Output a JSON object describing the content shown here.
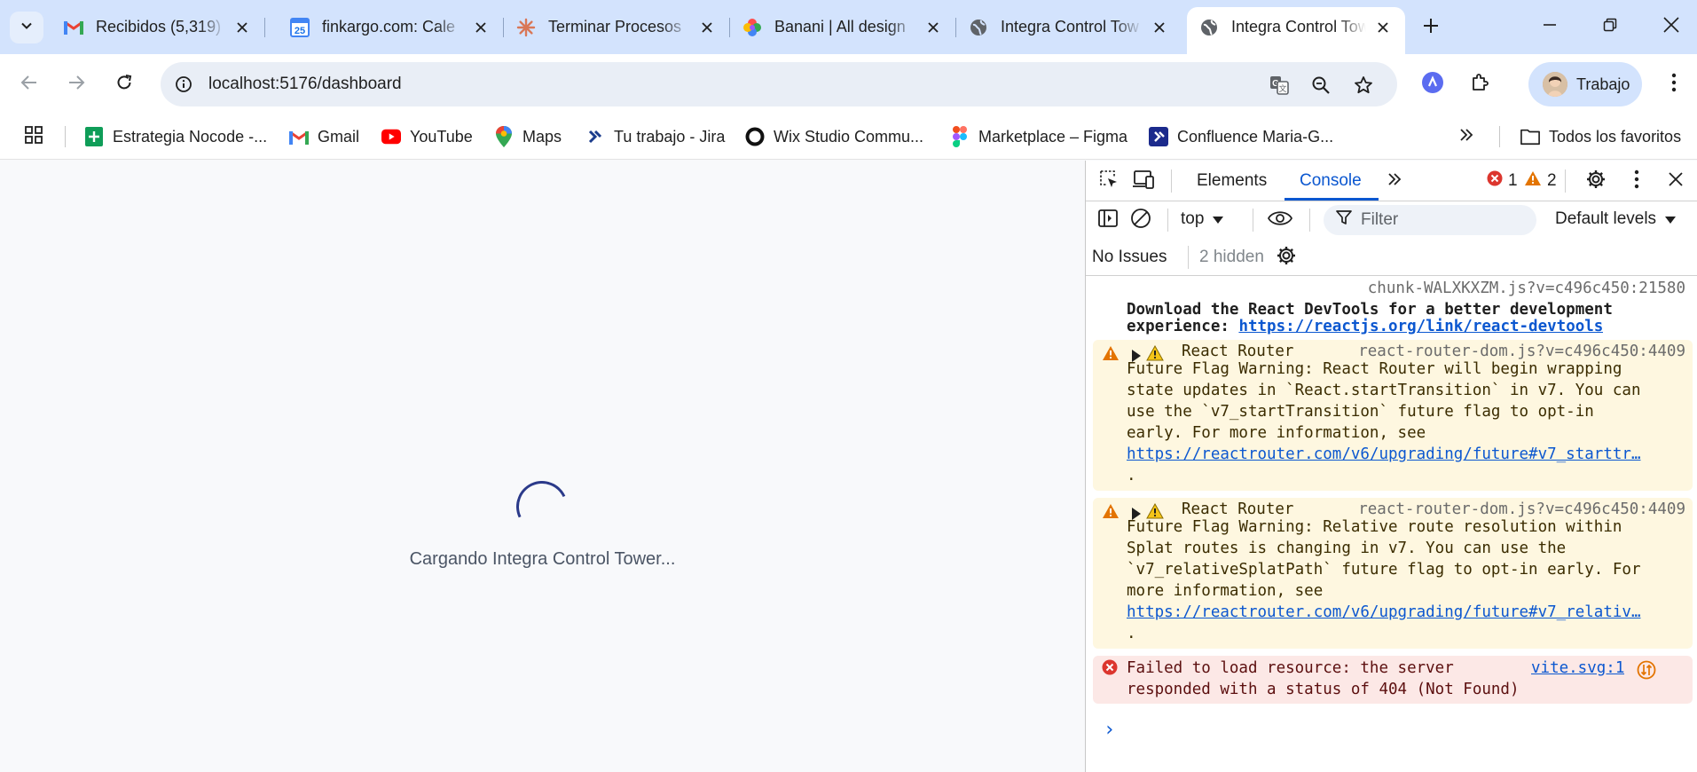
{
  "browser": {
    "tabs": [
      {
        "title": "Recibidos (5,319) -",
        "icon": "gmail-icon"
      },
      {
        "title": "finkargo.com: Cale",
        "icon": "calendar-icon"
      },
      {
        "title": "Terminar Procesos",
        "icon": "claude-icon"
      },
      {
        "title": "Banani | All design",
        "icon": "banani-icon"
      },
      {
        "title": "Integra Control Tow",
        "icon": "globe-icon"
      },
      {
        "title": "Integra Control Tow",
        "icon": "globe-icon",
        "active": true
      }
    ],
    "calendar_day": "25",
    "url": "localhost:5176/dashboard",
    "profile_label": "Trabajo"
  },
  "bookmarks": {
    "items": [
      {
        "label": "Estrategia Nocode -..."
      },
      {
        "label": "Gmail"
      },
      {
        "label": "YouTube"
      },
      {
        "label": "Maps"
      },
      {
        "label": "Tu trabajo - Jira"
      },
      {
        "label": "Wix Studio Commu..."
      },
      {
        "label": "Marketplace – Figma"
      },
      {
        "label": "Confluence Maria-G..."
      }
    ],
    "more_label": "Todos los favoritos"
  },
  "page": {
    "loading_text": "Cargando Integra Control Tower..."
  },
  "devtools": {
    "tabs": {
      "elements": "Elements",
      "console": "Console"
    },
    "error_count": "1",
    "warning_count": "2",
    "context": "top",
    "filter_placeholder": "Filter",
    "levels": "Default levels",
    "issues": "No Issues",
    "hidden": "2 hidden",
    "messages": {
      "info": {
        "source": "chunk-WALXKXZM.js?v=c496c450:21580",
        "line1": "Download the React DevTools for a better development",
        "line2_prefix": "experience: ",
        "link": "https://reactjs.org/link/react-devtools"
      },
      "warn1": {
        "head": "React Router",
        "source": "react-router-dom.js?v=c496c450:4409",
        "lines": [
          "Future Flag Warning: React Router will begin wrapping",
          "state updates in `React.startTransition` in v7. You can",
          "use the `v7_startTransition` future flag to opt-in",
          "early. For more information, see"
        ],
        "link": "https://reactrouter.com/v6/upgrading/future#v7_starttr…",
        "tail": "."
      },
      "warn2": {
        "head": "React Router",
        "source": "react-router-dom.js?v=c496c450:4409",
        "lines": [
          "Future Flag Warning: Relative route resolution within",
          "Splat routes is changing in v7. You can use the",
          "`v7_relativeSplatPath` future flag to opt-in early. For",
          "more information, see"
        ],
        "link": "https://reactrouter.com/v6/upgrading/future#v7_relativ…",
        "tail": "."
      },
      "error": {
        "line1": "Failed to load resource: the server",
        "line2": "responded with a status of 404 (Not Found)",
        "source": "vite.svg:1"
      }
    },
    "prompt": "›"
  },
  "colors": {
    "tabstrip": "#d3e3fd",
    "accent": "#0b57d0",
    "warn_bg": "#fef7e0",
    "error_bg": "#fce8e6",
    "spinner": "#2b3a8a"
  }
}
